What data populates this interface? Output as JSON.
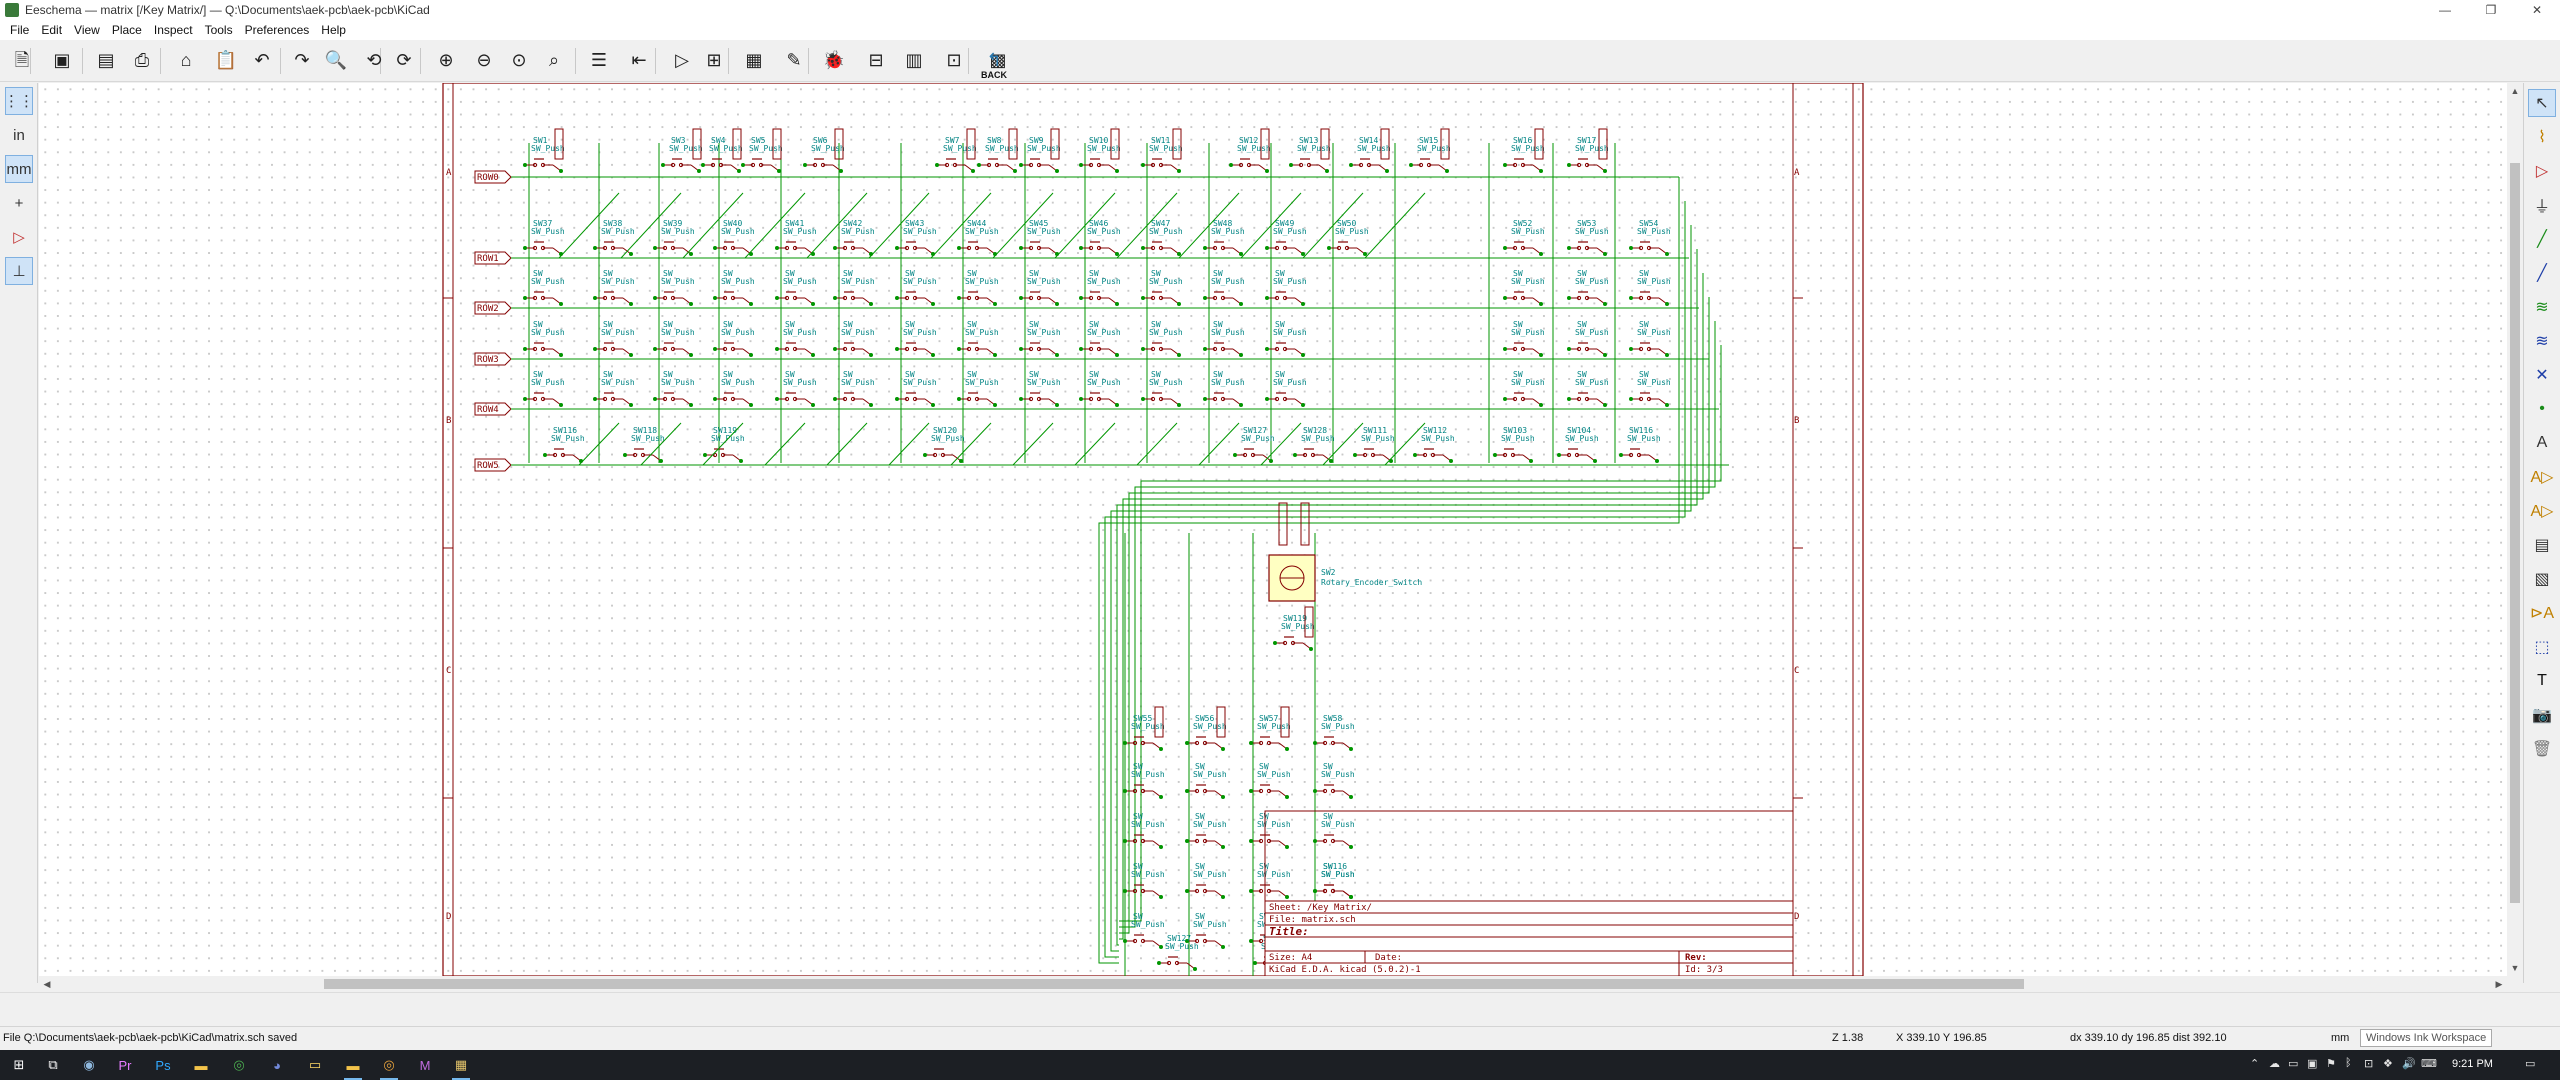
{
  "window": {
    "title": "Eeschema — matrix [/Key Matrix/] — Q:\\Documents\\aek-pcb\\aek-pcb\\KiCad",
    "controls": [
      "—",
      "❐",
      "✕"
    ]
  },
  "menubar": [
    "File",
    "Edit",
    "View",
    "Place",
    "Inspect",
    "Tools",
    "Preferences",
    "Help"
  ],
  "toolbar": {
    "back_label": "BACK",
    "tools": [
      {
        "name": "new-schematic-icon",
        "glyph": "🗎"
      },
      {
        "name": "save-icon",
        "glyph": "▣"
      },
      {
        "name": "page-settings-icon",
        "glyph": "▤"
      },
      {
        "name": "print-icon",
        "glyph": "⎙"
      },
      {
        "name": "plot-icon",
        "glyph": "⌂"
      },
      {
        "name": "paste-icon",
        "glyph": "📋"
      },
      {
        "name": "undo-icon",
        "glyph": "↶"
      },
      {
        "name": "redo-icon",
        "glyph": "↷"
      },
      {
        "name": "find-icon",
        "glyph": "🔍"
      },
      {
        "name": "find-replace-icon",
        "glyph": "⟲"
      },
      {
        "name": "redraw-icon",
        "glyph": "⟳"
      },
      {
        "name": "zoom-in-icon",
        "glyph": "⊕"
      },
      {
        "name": "zoom-out-icon",
        "glyph": "⊖"
      },
      {
        "name": "zoom-fit-icon",
        "glyph": "⊙"
      },
      {
        "name": "zoom-selection-icon",
        "glyph": "⌕"
      },
      {
        "name": "hierarchy-navigator-icon",
        "glyph": "☰"
      },
      {
        "name": "leave-sheet-icon",
        "glyph": "⇤"
      },
      {
        "name": "symbol-editor-icon",
        "glyph": "▷"
      },
      {
        "name": "symbol-browser-icon",
        "glyph": "⊞"
      },
      {
        "name": "footprint-assign-icon",
        "glyph": "▦"
      },
      {
        "name": "annotate-icon",
        "glyph": "✎"
      },
      {
        "name": "erc-icon",
        "glyph": "🐞"
      },
      {
        "name": "netlist-icon",
        "glyph": "⊟"
      },
      {
        "name": "bom-icon",
        "glyph": "▥"
      },
      {
        "name": "simulator-icon",
        "glyph": "⊡"
      },
      {
        "name": "pcbnew-icon",
        "glyph": "▩"
      }
    ]
  },
  "left_tools": [
    {
      "name": "grid-toggle-icon",
      "glyph": "⋮⋮",
      "active": true
    },
    {
      "name": "units-inch-icon",
      "glyph": "in",
      "active": false
    },
    {
      "name": "units-mm-icon",
      "glyph": "mm",
      "active": true
    },
    {
      "name": "cursor-shape-icon",
      "glyph": "+",
      "active": false
    },
    {
      "name": "hidden-pins-icon",
      "glyph": "▷",
      "active": false
    },
    {
      "name": "orthogonal-wires-icon",
      "glyph": "⊥",
      "active": true
    }
  ],
  "right_tools": [
    {
      "name": "select-icon",
      "glyph": "↖",
      "active": true
    },
    {
      "name": "highlight-net-icon",
      "glyph": "⌇",
      "active": false
    },
    {
      "name": "add-symbol-icon",
      "glyph": "▷",
      "active": false
    },
    {
      "name": "add-power-icon",
      "glyph": "⏚",
      "active": false
    },
    {
      "name": "add-wire-icon",
      "glyph": "╱",
      "active": false
    },
    {
      "name": "add-bus-icon",
      "glyph": "╱",
      "active": false
    },
    {
      "name": "wire-bus-entry-icon",
      "glyph": "≋",
      "active": false
    },
    {
      "name": "bus-bus-entry-icon",
      "glyph": "≋",
      "active": false
    },
    {
      "name": "no-connect-icon",
      "glyph": "✕",
      "active": false
    },
    {
      "name": "add-junction-icon",
      "glyph": "•",
      "active": false
    },
    {
      "name": "add-label-icon",
      "glyph": "A",
      "active": false
    },
    {
      "name": "add-global-label-icon",
      "glyph": "A▷",
      "active": false
    },
    {
      "name": "add-hier-label-icon",
      "glyph": "A▷",
      "active": false
    },
    {
      "name": "add-sheet-icon",
      "glyph": "▤",
      "active": false
    },
    {
      "name": "import-sheet-pin-icon",
      "glyph": "▧",
      "active": false
    },
    {
      "name": "add-sheet-pin-icon",
      "glyph": "⊳A",
      "active": false
    },
    {
      "name": "add-graphic-lines-icon",
      "glyph": "⬚",
      "active": false
    },
    {
      "name": "add-text-icon",
      "glyph": "T",
      "active": false
    },
    {
      "name": "add-image-icon",
      "glyph": "📷",
      "active": false
    },
    {
      "name": "delete-icon",
      "glyph": "🗑",
      "active": false
    }
  ],
  "schematic": {
    "row_labels": [
      "ROW0",
      "ROW1",
      "ROW2",
      "ROW3",
      "ROW4",
      "ROW5"
    ],
    "border_letters": [
      "A",
      "B",
      "C",
      "D"
    ],
    "row0_switches": [
      "SW1",
      "SW3",
      "SW4",
      "SW5",
      "SW6",
      "SW7",
      "SW8",
      "SW9",
      "SW10",
      "SW11",
      "SW12",
      "SW13",
      "SW14",
      "SW15",
      "SW16",
      "SW17"
    ],
    "row1_switches": [
      "SW37",
      "SW38",
      "SW39",
      "SW40",
      "SW41",
      "SW42",
      "SW43",
      "SW44",
      "SW45",
      "SW46",
      "SW47",
      "SW48",
      "SW49",
      "SW50",
      "SW52",
      "SW53",
      "SW54"
    ],
    "numpad_switches": [
      "SW55",
      "SW56",
      "SW57",
      "SW58"
    ],
    "extra_switches": [
      "SW116",
      "SW118",
      "SW119",
      "SW120",
      "SW127",
      "SW128",
      "SW111",
      "SW112",
      "SW103",
      "SW104"
    ],
    "pushbutton_value": "SW_Push",
    "encoder_ref": "SW2",
    "encoder_value": "Rotary_Encoder_Switch",
    "title_block": {
      "sheet": "Sheet: /Key Matrix/",
      "file": "File: matrix.sch",
      "title": "Title:",
      "size": "Size: A4",
      "date": "Date:",
      "rev": "Rev:",
      "kicad": "KiCad E.D.A.  kicad (5.0.2)-1",
      "id": "Id: 3/3"
    }
  },
  "colors": {
    "wire": "#009600",
    "component": "#840000",
    "component_fill": "#ffffc2",
    "symbol_text": "#008484",
    "border": "#840000",
    "label_text": "#840000"
  },
  "message_panel": "",
  "statusbar": {
    "file_message": "File Q:\\Documents\\aek-pcb\\aek-pcb\\KiCad\\matrix.sch saved",
    "zoom": "Z 1.38",
    "cursor": "X 339.10  Y 196.85",
    "delta": "dx 339.10  dy 196.85  dist 392.10",
    "units": "mm",
    "tooltip": "Windows Ink Workspace"
  },
  "taskbar": {
    "apps": [
      {
        "name": "start-icon",
        "glyph": "⊞",
        "color": "#ffffff",
        "open": false
      },
      {
        "name": "task-view-icon",
        "glyph": "⧉",
        "color": "#ffffff",
        "open": false
      },
      {
        "name": "steam-icon",
        "glyph": "◉",
        "color": "#8fb8de",
        "open": false
      },
      {
        "name": "premiere-icon",
        "glyph": "Pr",
        "color": "#e77cff",
        "open": false
      },
      {
        "name": "photoshop-icon",
        "glyph": "Ps",
        "color": "#31a8ff",
        "open": false
      },
      {
        "name": "file-explorer-icon",
        "glyph": "▬",
        "color": "#f3c34a",
        "open": false
      },
      {
        "name": "chrome-icon",
        "glyph": "◎",
        "color": "#4caf50",
        "open": false
      },
      {
        "name": "discord-icon",
        "glyph": "◕",
        "color": "#7289da",
        "open": false
      },
      {
        "name": "sticky-notes-icon",
        "glyph": "▭",
        "color": "#ffd866",
        "open": false
      },
      {
        "name": "kicad-folder-icon",
        "glyph": "▬",
        "color": "#f3c34a",
        "open": true
      },
      {
        "name": "chrome-profile-icon",
        "glyph": "◎",
        "color": "#e8a33d",
        "open": true
      },
      {
        "name": "mail-app-icon",
        "glyph": "M",
        "color": "#c06ce0",
        "open": false
      },
      {
        "name": "eeschema-app-icon",
        "glyph": "▦",
        "color": "#e2c36b",
        "open": true
      }
    ],
    "tray": [
      "⌃",
      "☁",
      "▭",
      "▣",
      "⚑",
      "ᛒ",
      "⊡",
      "❖",
      "🔊",
      "⌨"
    ],
    "clock": "9:21 PM",
    "notification": "▭"
  }
}
